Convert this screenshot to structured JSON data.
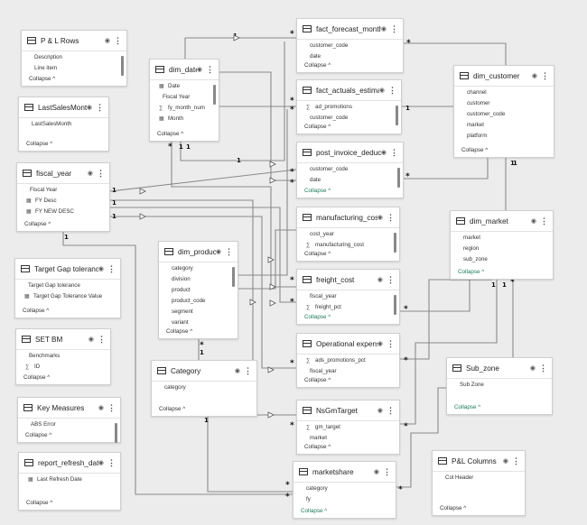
{
  "tables": {
    "p_l_rows": {
      "title": "P & L Rows",
      "fields": [
        "Description",
        "Line item"
      ],
      "collapse": "Collapse"
    },
    "last_sales_month": {
      "title": "LastSalesMonth",
      "fields": [
        "LastSalesMonth"
      ],
      "collapse": "Collapse"
    },
    "fiscal_year": {
      "title": "fiscal_year",
      "fields": [
        "Fiscal Year",
        "FY Desc",
        "FY NEW DESC"
      ],
      "collapse": "Collapse"
    },
    "target_gap": {
      "title": "Target Gap tolerance",
      "fields": [
        "Target Gap tolerance",
        "Target Gap Tolerance Value"
      ],
      "collapse": "Collapse"
    },
    "set_bm": {
      "title": "SET BM",
      "fields": [
        "Benchmarks",
        "ID"
      ],
      "collapse": "Collapse"
    },
    "key_measures": {
      "title": "Key Measures",
      "fields": [
        "ABS Error"
      ],
      "collapse": "Collapse"
    },
    "report_refresh": {
      "title": "report_refresh_date",
      "fields": [
        "Last Refresh Date"
      ],
      "collapse": "Collapse"
    },
    "dim_date": {
      "title": "dim_date",
      "fields": [
        "Date",
        "Fiscal Year",
        "fy_month_num",
        "Month"
      ],
      "collapse": "Collapse"
    },
    "dim_product": {
      "title": "dim_product",
      "fields": [
        "category",
        "division",
        "product",
        "product_code",
        "segment",
        "variant"
      ],
      "collapse": "Collapse"
    },
    "category": {
      "title": "Category",
      "fields": [
        "category"
      ],
      "collapse": "Collapse"
    },
    "fact_forecast": {
      "title": "fact_forecast_monthly",
      "fields": [
        "customer_code",
        "date"
      ],
      "collapse": "Collapse"
    },
    "fact_actuals": {
      "title": "fact_actuals_estimates",
      "fields": [
        "ad_promotions",
        "customer_code"
      ],
      "collapse": "Collapse"
    },
    "post_invoice": {
      "title": "post_invoice_deducti...",
      "fields": [
        "customer_code",
        "date"
      ],
      "collapse": "Collapse"
    },
    "manufacturing": {
      "title": "manufacturing_cost",
      "fields": [
        "cost_year",
        "manufacturing_cost"
      ],
      "collapse": "Collapse"
    },
    "freight": {
      "title": "freight_cost",
      "fields": [
        "fiscal_year",
        "freight_pct"
      ],
      "collapse": "Collapse"
    },
    "operational": {
      "title": "Operational expense",
      "fields": [
        "ads_promotions_pct",
        "fiscal_year"
      ],
      "collapse": "Collapse"
    },
    "nsgm": {
      "title": "NsGmTarget",
      "fields": [
        "gm_target",
        "market"
      ],
      "collapse": "Collapse"
    },
    "marketshare": {
      "title": "marketshare",
      "fields": [
        "category",
        "fy"
      ],
      "collapse": "Collapse"
    },
    "dim_customer": {
      "title": "dim_customer",
      "fields": [
        "channel",
        "customer",
        "customer_code",
        "market",
        "platform"
      ],
      "collapse": "Collapse"
    },
    "dim_market": {
      "title": "dim_market",
      "fields": [
        "market",
        "region",
        "sub_zone"
      ],
      "collapse": "Collapse"
    },
    "sub_zone": {
      "title": "Sub_zone",
      "fields": [
        "Sub Zone"
      ],
      "collapse": "Collapse"
    },
    "pl_columns": {
      "title": "P&L Columns",
      "fields": [
        "Col Header"
      ],
      "collapse": "Collapse"
    }
  },
  "cardinality": {
    "one": "1",
    "many": "*"
  },
  "colors": {
    "line": "#8a8a8a",
    "collapse_green": "#1d7a5f"
  }
}
